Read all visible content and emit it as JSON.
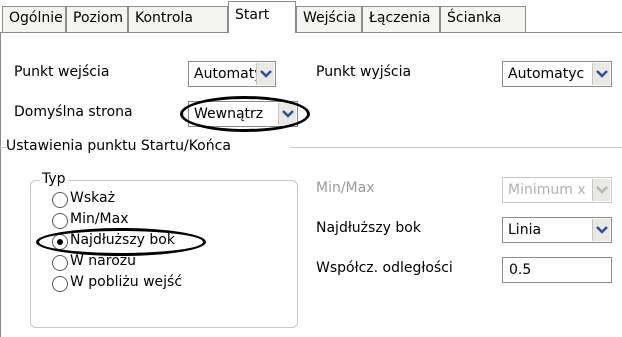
{
  "tabs": [
    {
      "label": "Ogólnie"
    },
    {
      "label": "Poziom"
    },
    {
      "label": "Kontrola"
    },
    {
      "label": "Start"
    },
    {
      "label": "Wejścia"
    },
    {
      "label": "Łączenia"
    },
    {
      "label": "Ścianka"
    }
  ],
  "entry": {
    "label": "Punkt wejścia",
    "value": "Automatyc"
  },
  "exit": {
    "label": "Punkt wyjścia",
    "value": "Automatyc"
  },
  "default_side": {
    "label": "Domyślna strona",
    "value": "Wewnątrz"
  },
  "settings_section": {
    "title": "Ustawienia punktu Startu/Końca"
  },
  "type_group": {
    "title": "Typ",
    "options": [
      {
        "label": "Wskaż",
        "checked": false
      },
      {
        "label": "Min/Max",
        "checked": false
      },
      {
        "label": "Najdłuższy bok",
        "checked": true
      },
      {
        "label": "W narożu",
        "checked": false
      },
      {
        "label": "W pobliżu wejść",
        "checked": false
      }
    ]
  },
  "minmax": {
    "label": "Min/Max",
    "value": "Minimum x"
  },
  "longest_side": {
    "label": "Najdłuższy bok",
    "value": "Linia"
  },
  "distance_coef": {
    "label": "Współcz. odległości",
    "value": "0.5"
  },
  "icons": {
    "dropdown": "chevron-down-icon",
    "radio": "radio-button-icon"
  }
}
